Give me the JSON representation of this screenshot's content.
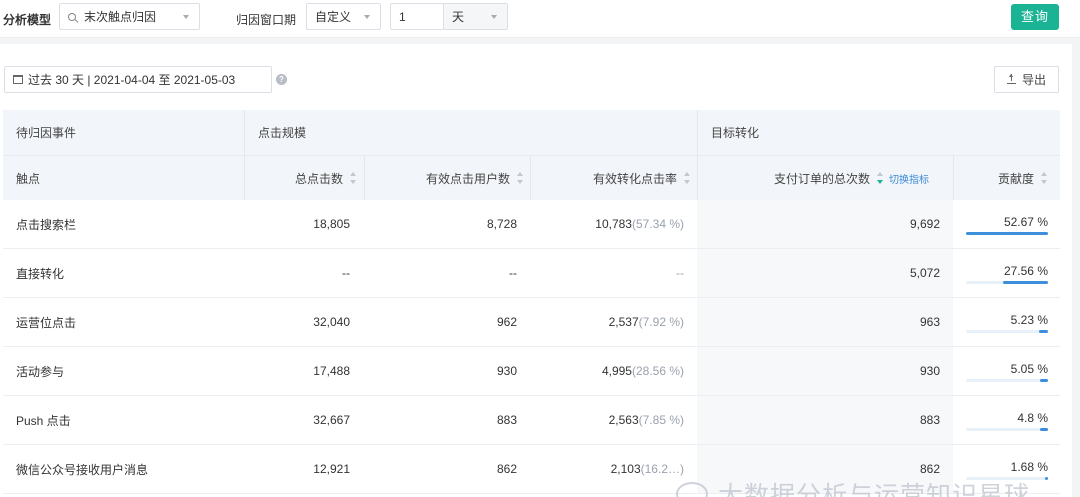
{
  "filters": {
    "model_label": "分析模型",
    "model_value": "末次触点归因",
    "window_label": "归因窗口期",
    "window_type": "自定义",
    "window_number": "1",
    "window_unit": "天",
    "query_button": "查询"
  },
  "toolbar": {
    "date_range": "过去 30 天 | 2021-04-04 至 2021-05-03",
    "export_label": "导出"
  },
  "table": {
    "group_headers": {
      "event": "待归因事件",
      "click_scale": "点击规模",
      "target": "目标转化"
    },
    "columns": {
      "touchpoint": "触点",
      "total_clicks": "总点击数",
      "valid_users": "有效点击用户数",
      "conversion_rate": "有效转化点击率",
      "orders": "支付订单的总次数",
      "switch_metric": "切换指标",
      "contribution": "贡献度"
    },
    "rows": [
      {
        "touchpoint": "点击搜索栏",
        "total_clicks": "18,805",
        "valid_users": "8,728",
        "conv": "10,783",
        "conv_pct": "(57.34 %)",
        "orders": "9,692",
        "contribution": "52.67 %",
        "contribution_fraction": 0.5267
      },
      {
        "touchpoint": "直接转化",
        "total_clicks": "--",
        "valid_users": "--",
        "conv": "",
        "conv_pct": "--",
        "orders": "5,072",
        "contribution": "27.56 %",
        "contribution_fraction": 0.2756
      },
      {
        "touchpoint": "运营位点击",
        "total_clicks": "32,040",
        "valid_users": "962",
        "conv": "2,537",
        "conv_pct": "(7.92 %)",
        "orders": "963",
        "contribution": "5.23 %",
        "contribution_fraction": 0.0523
      },
      {
        "touchpoint": "活动参与",
        "total_clicks": "17,488",
        "valid_users": "930",
        "conv": "4,995",
        "conv_pct": "(28.56 %)",
        "orders": "930",
        "contribution": "5.05 %",
        "contribution_fraction": 0.0505
      },
      {
        "touchpoint": "Push 点击",
        "total_clicks": "32,667",
        "valid_users": "883",
        "conv": "2,563",
        "conv_pct": "(7.85 %)",
        "orders": "883",
        "contribution": "4.8 %",
        "contribution_fraction": 0.048
      },
      {
        "touchpoint": "微信公众号接收用户消息",
        "total_clicks": "12,921",
        "valid_users": "862",
        "conv": "2,103",
        "conv_pct": "(16.2…)",
        "orders": "862",
        "contribution": "1.68 %",
        "contribution_fraction": 0.0168
      }
    ]
  },
  "watermark": "大数据分析与运营知识星球",
  "colors": {
    "accent": "#1ab394",
    "bar": "#3d8fdc",
    "header_bg": "#f2f5f9"
  }
}
